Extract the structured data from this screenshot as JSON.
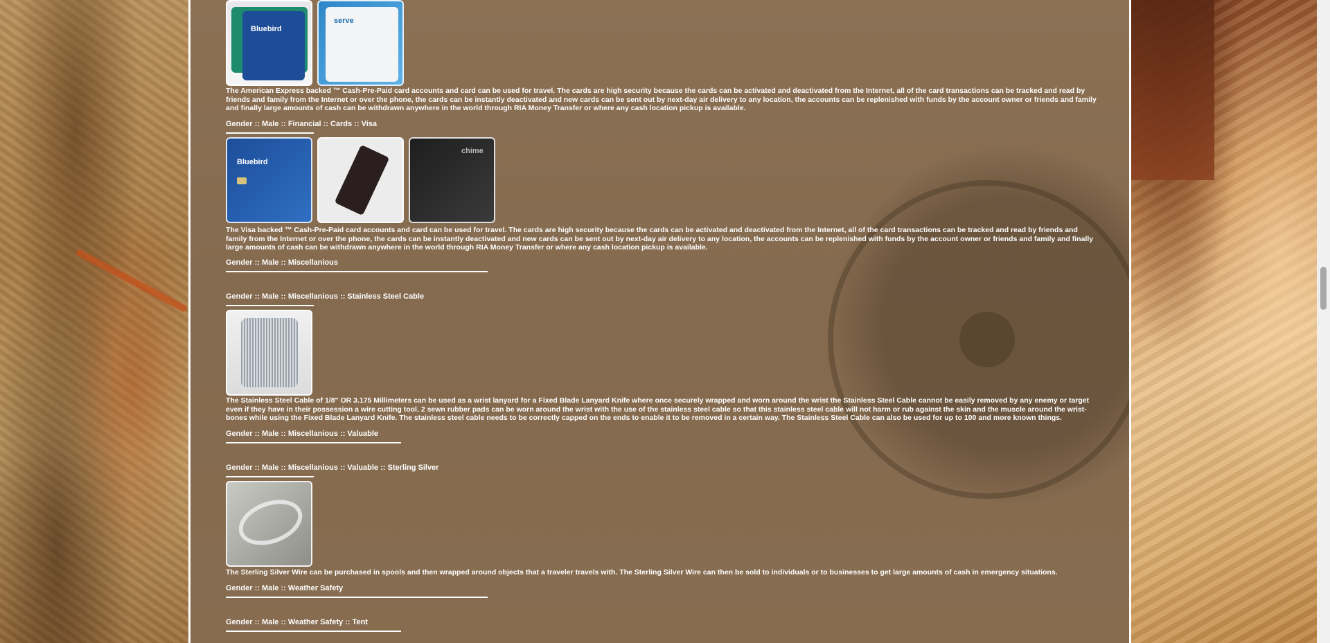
{
  "sections": [
    {
      "heading": "",
      "images": [
        {
          "name": "amex-bluebird-card",
          "caption": "Bluebird"
        },
        {
          "name": "amex-serve-card",
          "caption": "serve"
        }
      ],
      "description": "The American Express backed ™ Cash-Pre-Paid card accounts and card can be used for travel. The cards are high security because the cards can be activated and deactivated from the Internet, all of the card transactions can be tracked and read by friends and family from the Internet or over the phone, the cards can be instantly deactivated and new cards can be sent out by next-day air delivery to any location, the accounts can be replenished with funds by the account owner or friends and family and finally large amounts of cash can be withdrawn anywhere in the world through RIA Money Transfer or where any cash location pickup is available."
    },
    {
      "heading": "Gender :: Male :: Financial :: Cards :: Visa",
      "images": [
        {
          "name": "visa-bluebird-card",
          "caption": "Bluebird"
        },
        {
          "name": "visa-black-card",
          "caption": ""
        },
        {
          "name": "visa-chime-card",
          "caption": "chime"
        }
      ],
      "description": "The Visa backed ™ Cash-Pre-Paid card accounts and card can be used for travel. The cards are high security because the cards can be activated and deactivated from the Internet, all of the card transactions can be tracked and read by friends and family from the Internet or over the phone, the cards can be instantly deactivated and new cards can be sent out by next-day air delivery to any location, the accounts can be replenished with funds by the account owner or friends and family and finally large amounts of cash can be withdrawn anywhere in the world through RIA Money Transfer or where any cash location pickup is available."
    },
    {
      "heading": "Gender :: Male :: Miscellanious"
    },
    {
      "heading": "Gender :: Male :: Miscellanious :: Stainless Steel Cable",
      "images": [
        {
          "name": "stainless-steel-cable-spool",
          "caption": ""
        }
      ],
      "description": "The Stainless Steel Cable of 1/8\" OR 3.175 Millimeters can be used as a wrist lanyard for a Fixed Blade Lanyard Knife where once securely wrapped and worn around the wrist the Stainless Steel Cable cannot be easily removed by any enemy or target even if they have in their possession a wire cutting tool. 2 sewn rubber pads can be worn around the wrist with the use of the stainless steel cable so that this stainless steel cable will not harm or rub against the skin and the muscle around the wrist-bones while using the Fixed Blade Lanyard Knife. The stainless steel cable needs to be correctly capped on the ends to enable it to be removed in a certain way. The Stainless Steel Cable can also be used for up to 100 and more known things."
    },
    {
      "heading": "Gender :: Male :: Miscellanious :: Valuable"
    },
    {
      "heading": "Gender :: Male :: Miscellanious :: Valuable :: Sterling Silver",
      "images": [
        {
          "name": "sterling-silver-wire",
          "caption": ""
        }
      ],
      "description": "The Sterling Silver Wire can be purchased in spools and then wrapped around objects that a traveler travels with. The Sterling Silver Wire can then be sold to individuals or to businesses to get large amounts of cash in emergency situations."
    },
    {
      "heading": "Gender :: Male :: Weather Safety"
    },
    {
      "heading": "Gender :: Male :: Weather Safety :: Tent"
    }
  ]
}
